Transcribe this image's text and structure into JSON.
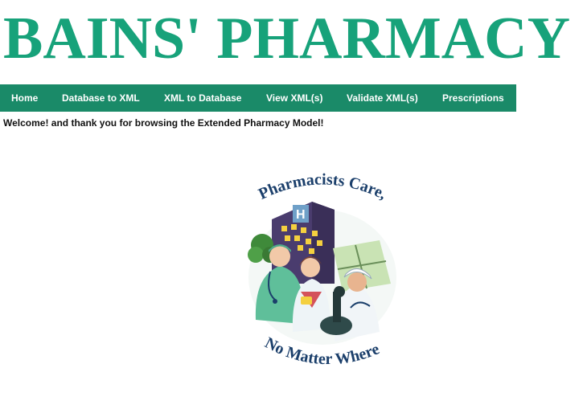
{
  "header": {
    "title": "BAINS' PHARMACY"
  },
  "nav": {
    "items": [
      {
        "label": "Home"
      },
      {
        "label": "Database to XML"
      },
      {
        "label": "XML to Database"
      },
      {
        "label": "View XML(s)"
      },
      {
        "label": "Validate XML(s)"
      },
      {
        "label": "Prescriptions"
      }
    ]
  },
  "main": {
    "welcome": "Welcome! and thank you for browsing the Extended Pharmacy Model!",
    "poster": {
      "top_text": "Pharmacists Care,",
      "bottom_text": "No Matter Where"
    }
  },
  "colors": {
    "title": "#17a27a",
    "nav_bg": "#1a8a68",
    "nav_text": "#ffffff",
    "poster_text": "#1b3f6b"
  }
}
